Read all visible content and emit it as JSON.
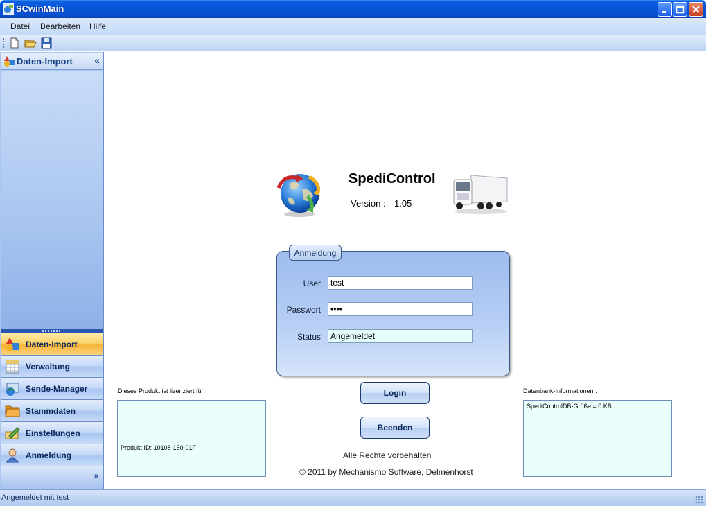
{
  "window": {
    "title": "SCwinMain"
  },
  "menu": {
    "items": [
      "Datei",
      "Bearbeiten",
      "Hilfe"
    ]
  },
  "toolbar": {
    "buttons": [
      "new-document-icon",
      "open-folder-icon",
      "save-disk-icon"
    ]
  },
  "sidebar": {
    "header": "Daten-Import",
    "collapse_glyph": "«",
    "items": [
      {
        "label": "Daten-Import",
        "icon": "shapes-icon",
        "active": true
      },
      {
        "label": "Verwaltung",
        "icon": "spreadsheet-icon",
        "active": false
      },
      {
        "label": "Sende-Manager",
        "icon": "send-manager-icon",
        "active": false
      },
      {
        "label": "Stammdaten",
        "icon": "folder-icon",
        "active": false
      },
      {
        "label": "Einstellungen",
        "icon": "settings-pen-icon",
        "active": false
      },
      {
        "label": "Anmeldung",
        "icon": "user-icon",
        "active": false
      }
    ],
    "more_glyph": "»"
  },
  "product": {
    "name": "SpediControl",
    "version_label": "Version :",
    "version": "1.05"
  },
  "login": {
    "group_title": "Anmeldung",
    "user_label": "User",
    "user_value": "test",
    "password_label": "Passwort",
    "password_value": "••••",
    "status_label": "Status",
    "status_value": "Angemeldet",
    "login_button": "Login",
    "exit_button": "Beenden"
  },
  "license": {
    "label": "Dieses Produkt ist lizenziert für :",
    "product_id": "Produkt ID: 10108-150-01F"
  },
  "database": {
    "label": "Datenbank-Informationen :",
    "size": "SpediControlDB-Größe = 0 KB"
  },
  "footer": {
    "rights": "Alle Rechte vorbehalten",
    "copyright": "© 2011 by Mechanismo Software, Delmenhorst"
  },
  "status_bar": {
    "text": "Angemeldet mit test"
  },
  "colors": {
    "title_bar": "#0753d6",
    "active_nav": "#f8b33a",
    "panel": "#a9c5f0",
    "info_box": "#eafefc"
  }
}
